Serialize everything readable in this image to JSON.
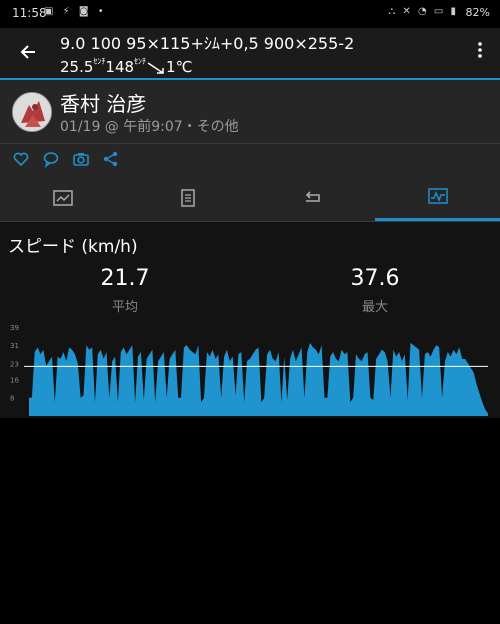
{
  "status": {
    "time": "11:58",
    "left_icons": "▣ ⚡ ◙ •",
    "right_icons": "⛬ ✕ ◔ ▭ ▮",
    "battery": "82%"
  },
  "header": {
    "line1": "9.0 100 95×115+ｼﾑ+0,5 900×255-2",
    "line2_a": "25.5",
    "line2_unit_a": "ｾﾝﾁ",
    "line2_b": "148",
    "line2_unit_b": "ｾﾝﾁ",
    "line2_c": "1℃"
  },
  "profile": {
    "name": "香村 治彦",
    "meta": "01/19 @ 午前9:07・その他"
  },
  "actions": [
    "heart-icon",
    "comment-icon",
    "camera-icon",
    "share-icon"
  ],
  "tabs": [
    {
      "icon": "summary-icon",
      "active": false
    },
    {
      "icon": "details-icon",
      "active": false
    },
    {
      "icon": "laps-icon",
      "active": false
    },
    {
      "icon": "chart-icon",
      "active": true
    }
  ],
  "speed": {
    "title": "スピード (km/h)",
    "avg_value": "21.7",
    "avg_label": "平均",
    "max_value": "37.6",
    "max_label": "最大"
  },
  "chart_data": {
    "type": "area",
    "ylabel": "",
    "yticks": [
      39,
      31,
      23,
      16,
      8
    ],
    "ylim": [
      0,
      42
    ],
    "avg_line": 21.7,
    "fill_color": "#1f94cf",
    "values": [
      8,
      8,
      28,
      30,
      27,
      29,
      22,
      24,
      26,
      6,
      26,
      25,
      28,
      24,
      30,
      29,
      27,
      23,
      8,
      9,
      31,
      29,
      30,
      6,
      27,
      29,
      25,
      28,
      8,
      24,
      26,
      6,
      28,
      30,
      27,
      29,
      31,
      6,
      26,
      28,
      7,
      25,
      27,
      29,
      6,
      24,
      26,
      28,
      8,
      25,
      27,
      29,
      8,
      8,
      30,
      31,
      29,
      28,
      27,
      31,
      6,
      8,
      28,
      26,
      29,
      25,
      27,
      8,
      26,
      29,
      24,
      26,
      9,
      27,
      28,
      6,
      24,
      25,
      27,
      29,
      30,
      6,
      8,
      27,
      29,
      25,
      24,
      28,
      6,
      26,
      7,
      25,
      29,
      24,
      27,
      30,
      8,
      28,
      32,
      30,
      29,
      27,
      31,
      8,
      8,
      26,
      28,
      25,
      24,
      29,
      27,
      28,
      6,
      8,
      27,
      25,
      24,
      27,
      28,
      8,
      7,
      25,
      27,
      29,
      28,
      24,
      8,
      29,
      26,
      28,
      24,
      27,
      7,
      32,
      31,
      30,
      29,
      8,
      27,
      28,
      26,
      29,
      31,
      30,
      8,
      24,
      28,
      26,
      29,
      27,
      30,
      25,
      25,
      23,
      21,
      19,
      14,
      10,
      6,
      3,
      1
    ]
  }
}
